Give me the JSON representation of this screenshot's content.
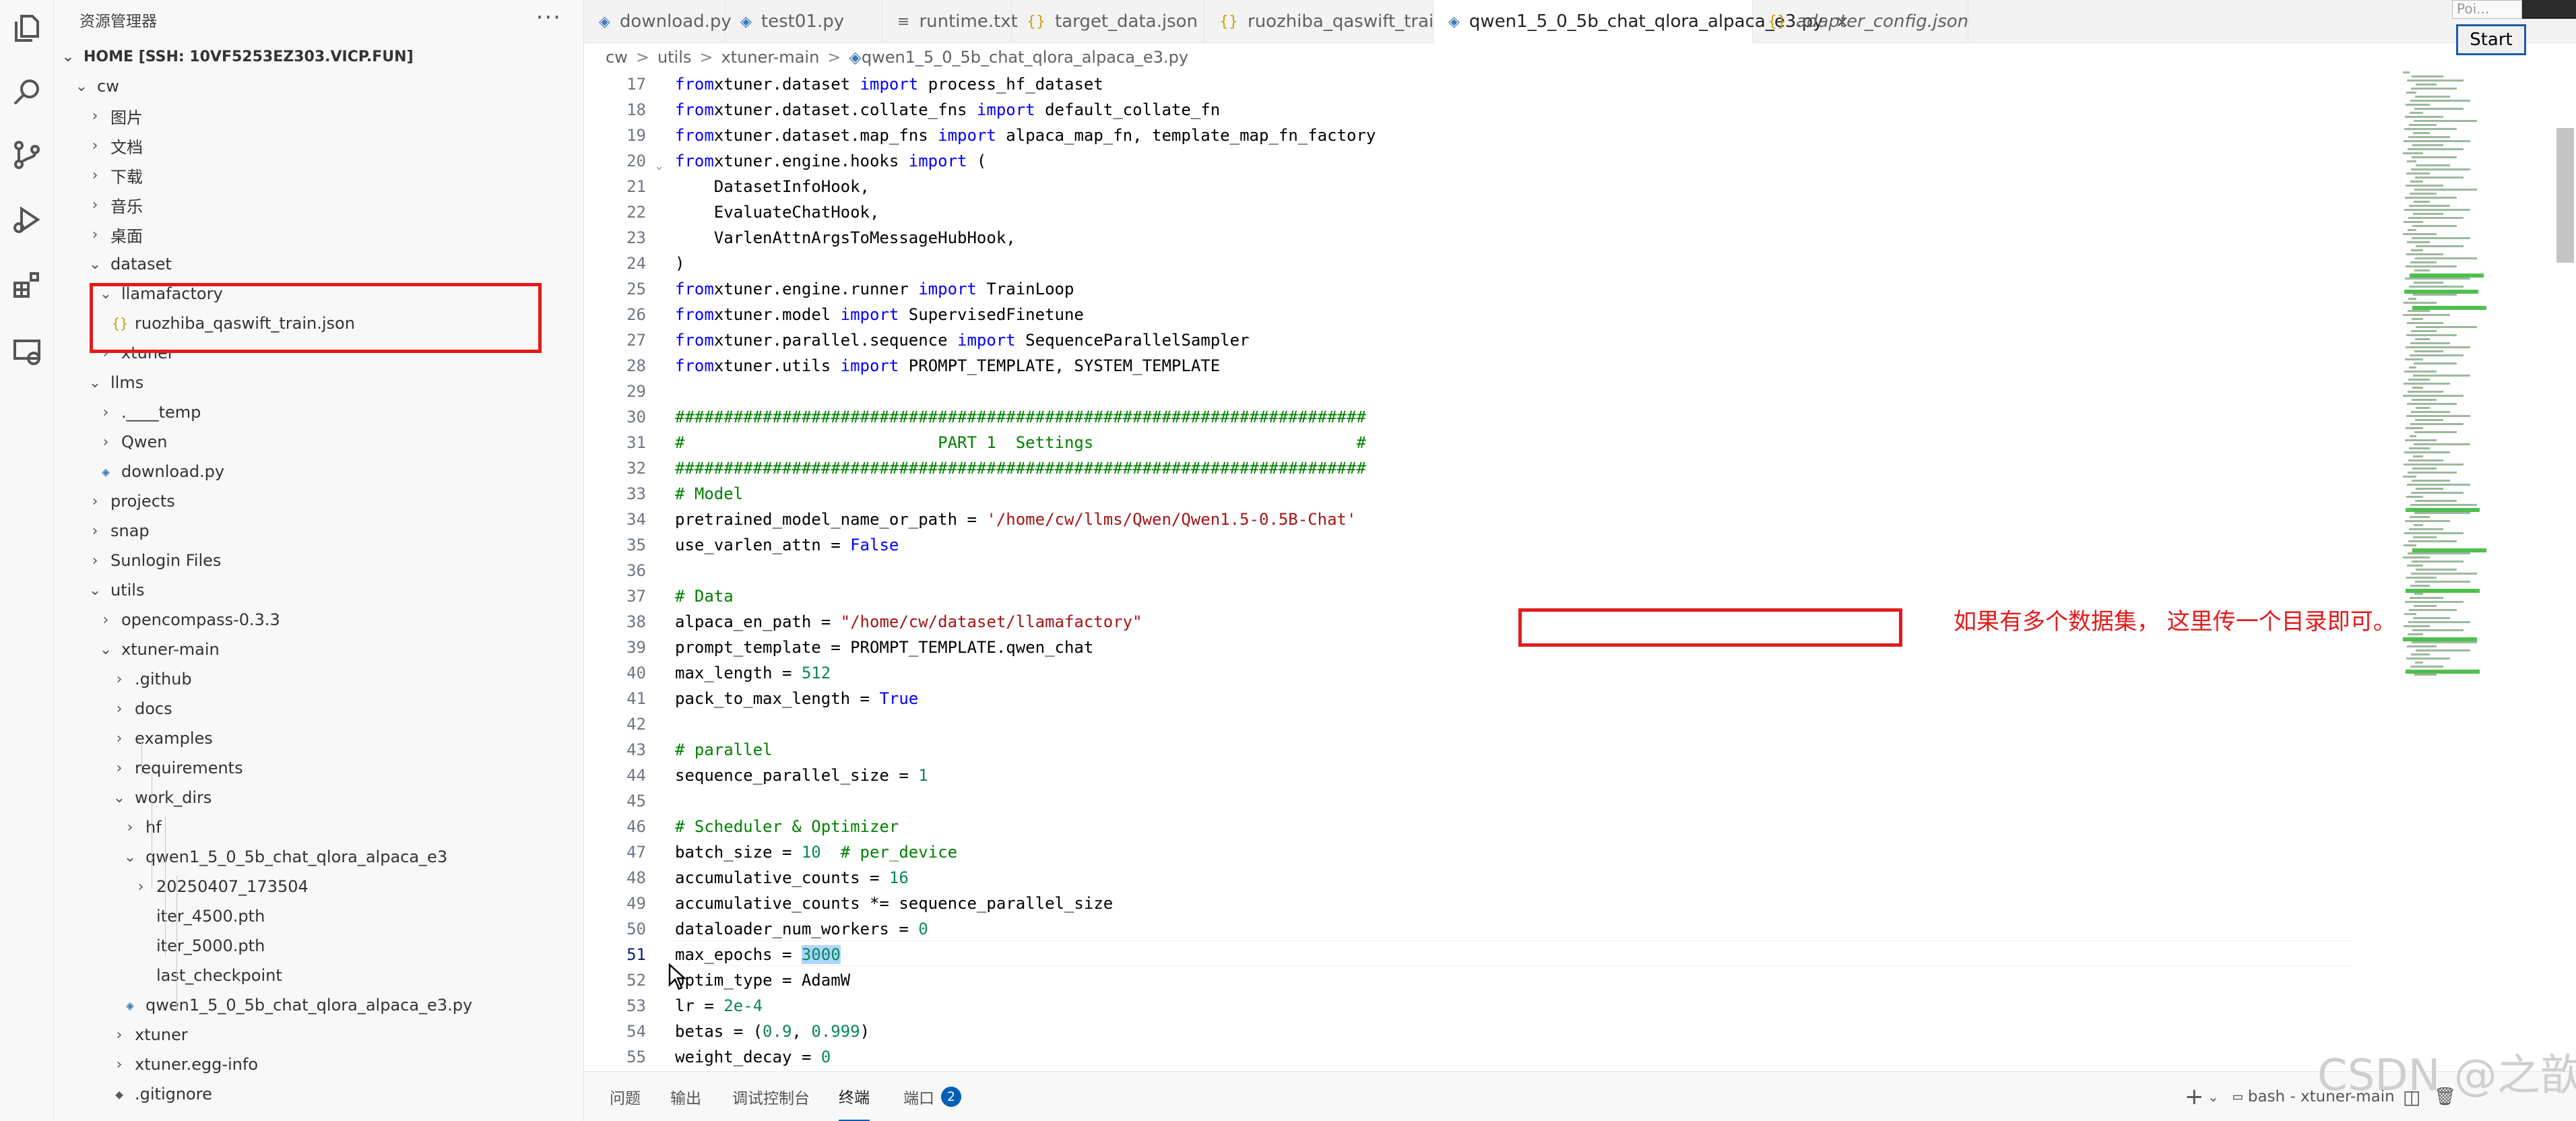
{
  "activity_bar": {
    "icons": [
      "files-icon",
      "search-icon",
      "source-control-icon",
      "run-debug-icon",
      "extensions-icon",
      "remote-explorer-icon"
    ]
  },
  "sidebar": {
    "title": "资源管理器",
    "more": "···",
    "root": "HOME [SSH: 10VF5253EZ303.VICP.FUN]",
    "items": [
      {
        "label": "cw",
        "depth": 0,
        "type": "folder",
        "open": true
      },
      {
        "label": "图片",
        "depth": 1,
        "type": "folder",
        "open": false
      },
      {
        "label": "文档",
        "depth": 1,
        "type": "folder",
        "open": false
      },
      {
        "label": "下载",
        "depth": 1,
        "type": "folder",
        "open": false
      },
      {
        "label": "音乐",
        "depth": 1,
        "type": "folder",
        "open": false
      },
      {
        "label": "桌面",
        "depth": 1,
        "type": "folder",
        "open": false
      },
      {
        "label": "dataset",
        "depth": 1,
        "type": "folder",
        "open": true
      },
      {
        "label": "llamafactory",
        "depth": 2,
        "type": "folder",
        "open": true
      },
      {
        "label": "ruozhiba_qaswift_train.json",
        "depth": 3,
        "type": "json"
      },
      {
        "label": "xtuner",
        "depth": 2,
        "type": "folder",
        "open": false
      },
      {
        "label": "llms",
        "depth": 1,
        "type": "folder",
        "open": true
      },
      {
        "label": ".____temp",
        "depth": 2,
        "type": "folder",
        "open": false
      },
      {
        "label": "Qwen",
        "depth": 2,
        "type": "folder",
        "open": false
      },
      {
        "label": "download.py",
        "depth": 2,
        "type": "py"
      },
      {
        "label": "projects",
        "depth": 1,
        "type": "folder",
        "open": false
      },
      {
        "label": "snap",
        "depth": 1,
        "type": "folder",
        "open": false
      },
      {
        "label": "Sunlogin Files",
        "depth": 1,
        "type": "folder",
        "open": false
      },
      {
        "label": "utils",
        "depth": 1,
        "type": "folder",
        "open": true
      },
      {
        "label": "opencompass-0.3.3",
        "depth": 2,
        "type": "folder",
        "open": false
      },
      {
        "label": "xtuner-main",
        "depth": 2,
        "type": "folder",
        "open": true
      },
      {
        "label": ".github",
        "depth": 3,
        "type": "folder",
        "open": false
      },
      {
        "label": "docs",
        "depth": 3,
        "type": "folder",
        "open": false
      },
      {
        "label": "examples",
        "depth": 3,
        "type": "folder",
        "open": false
      },
      {
        "label": "requirements",
        "depth": 3,
        "type": "folder",
        "open": false
      },
      {
        "label": "work_dirs",
        "depth": 3,
        "type": "folder",
        "open": true
      },
      {
        "label": "hf",
        "depth": 4,
        "type": "folder",
        "open": false
      },
      {
        "label": "qwen1_5_0_5b_chat_qlora_alpaca_e3",
        "depth": 4,
        "type": "folder",
        "open": true
      },
      {
        "label": "20250407_173504",
        "depth": 5,
        "type": "folder",
        "open": false
      },
      {
        "label": "iter_4500.pth",
        "depth": 5,
        "type": "file"
      },
      {
        "label": "iter_5000.pth",
        "depth": 5,
        "type": "file"
      },
      {
        "label": "last_checkpoint",
        "depth": 5,
        "type": "file"
      },
      {
        "label": "qwen1_5_0_5b_chat_qlora_alpaca_e3.py",
        "depth": 4,
        "type": "py"
      },
      {
        "label": "xtuner",
        "depth": 3,
        "type": "folder",
        "open": false
      },
      {
        "label": "xtuner.egg-info",
        "depth": 3,
        "type": "folder",
        "open": false
      },
      {
        "label": ".gitignore",
        "depth": 3,
        "type": "git"
      }
    ]
  },
  "tabs": [
    {
      "label": "download.py",
      "type": "py"
    },
    {
      "label": "test01.py",
      "type": "py"
    },
    {
      "label": "runtime.txt",
      "type": "txt"
    },
    {
      "label": "target_data.json",
      "type": "json"
    },
    {
      "label": "ruozhiba_qaswift_train.json",
      "type": "json"
    },
    {
      "label": "qwen1_5_0_5b_chat_qlora_alpaca_e3.py",
      "type": "py",
      "active": true,
      "close": "×"
    },
    {
      "label": "adapter_config.json",
      "type": "json",
      "italic": true
    }
  ],
  "breadcrumb": [
    "cw",
    "utils",
    "xtuner-main",
    "qwen1_5_0_5b_chat_qlora_alpaca_e3.py"
  ],
  "breadcrumb_sep": ">",
  "editor": {
    "current_line": 51,
    "lines": [
      {
        "n": "17",
        "t": [
          [
            "kw",
            "from"
          ],
          [
            "",
            "xtuner.dataset "
          ],
          [
            "kw",
            "import"
          ],
          [
            "",
            " process_hf_dataset"
          ]
        ]
      },
      {
        "n": "18",
        "t": [
          [
            "kw",
            "from"
          ],
          [
            "",
            "xtuner.dataset.collate_fns "
          ],
          [
            "kw",
            "import"
          ],
          [
            "",
            " default_collate_fn"
          ]
        ]
      },
      {
        "n": "19",
        "t": [
          [
            "kw",
            "from"
          ],
          [
            "",
            "xtuner.dataset.map_fns "
          ],
          [
            "kw",
            "import"
          ],
          [
            "",
            " alpaca_map_fn, template_map_fn_factory"
          ]
        ]
      },
      {
        "n": "20",
        "t": [
          [
            "kw",
            "from"
          ],
          [
            "",
            "xtuner.engine.hooks "
          ],
          [
            "kw",
            "import"
          ],
          [
            "",
            " ("
          ]
        ]
      },
      {
        "n": "21",
        "t": [
          [
            "",
            "    DatasetInfoHook,"
          ]
        ]
      },
      {
        "n": "22",
        "t": [
          [
            "",
            "    EvaluateChatHook,"
          ]
        ]
      },
      {
        "n": "23",
        "t": [
          [
            "",
            "    VarlenAttnArgsToMessageHubHook,"
          ]
        ]
      },
      {
        "n": "24",
        "t": [
          [
            "",
            ")"
          ]
        ]
      },
      {
        "n": "25",
        "t": [
          [
            "kw",
            "from"
          ],
          [
            "",
            "xtuner.engine.runner "
          ],
          [
            "kw",
            "import"
          ],
          [
            "",
            " TrainLoop"
          ]
        ]
      },
      {
        "n": "26",
        "t": [
          [
            "kw",
            "from"
          ],
          [
            "",
            "xtuner.model "
          ],
          [
            "kw",
            "import"
          ],
          [
            "",
            " SupervisedFinetune"
          ]
        ]
      },
      {
        "n": "27",
        "t": [
          [
            "kw",
            "from"
          ],
          [
            "",
            "xtuner.parallel.sequence "
          ],
          [
            "kw",
            "import"
          ],
          [
            "",
            " SequenceParallelSampler"
          ]
        ]
      },
      {
        "n": "28",
        "t": [
          [
            "kw",
            "from"
          ],
          [
            "",
            "xtuner.utils "
          ],
          [
            "kw",
            "import"
          ],
          [
            "",
            " PROMPT_TEMPLATE, SYSTEM_TEMPLATE"
          ]
        ]
      },
      {
        "n": "29",
        "t": []
      },
      {
        "n": "30",
        "t": [
          [
            "cm",
            "#######################################################################"
          ]
        ]
      },
      {
        "n": "31",
        "t": [
          [
            "cm",
            "#                          PART 1  Settings                           #"
          ]
        ]
      },
      {
        "n": "32",
        "t": [
          [
            "cm",
            "#######################################################################"
          ]
        ]
      },
      {
        "n": "33",
        "t": [
          [
            "cm",
            "# Model"
          ]
        ]
      },
      {
        "n": "34",
        "t": [
          [
            "",
            "pretrained_model_name_or_path = "
          ],
          [
            "st",
            "'/home/cw/llms/Qwen/Qwen1.5-0.5B-Chat'"
          ]
        ]
      },
      {
        "n": "35",
        "t": [
          [
            "",
            "use_varlen_attn = "
          ],
          [
            "kw",
            "False"
          ]
        ]
      },
      {
        "n": "36",
        "t": []
      },
      {
        "n": "37",
        "t": [
          [
            "cm",
            "# Data"
          ]
        ]
      },
      {
        "n": "38",
        "t": [
          [
            "",
            "alpaca_en_path = "
          ],
          [
            "st",
            "\"/home/cw/dataset/llamafactory\""
          ]
        ]
      },
      {
        "n": "39",
        "t": [
          [
            "",
            "prompt_template = PROMPT_TEMPLATE.qwen_chat"
          ]
        ]
      },
      {
        "n": "40",
        "t": [
          [
            "",
            "max_length = "
          ],
          [
            "nm",
            "512"
          ]
        ]
      },
      {
        "n": "41",
        "t": [
          [
            "",
            "pack_to_max_length = "
          ],
          [
            "kw",
            "True"
          ]
        ]
      },
      {
        "n": "42",
        "t": []
      },
      {
        "n": "43",
        "t": [
          [
            "cm",
            "# parallel"
          ]
        ]
      },
      {
        "n": "44",
        "t": [
          [
            "",
            "sequence_parallel_size = "
          ],
          [
            "nm",
            "1"
          ]
        ]
      },
      {
        "n": "45",
        "t": []
      },
      {
        "n": "46",
        "t": [
          [
            "cm",
            "# Scheduler & Optimizer"
          ]
        ]
      },
      {
        "n": "47",
        "t": [
          [
            "",
            "batch_size = "
          ],
          [
            "nm",
            "10"
          ],
          [
            "",
            "  "
          ],
          [
            "cm",
            "# per_device"
          ]
        ]
      },
      {
        "n": "48",
        "t": [
          [
            "",
            "accumulative_counts = "
          ],
          [
            "nm",
            "16"
          ]
        ]
      },
      {
        "n": "49",
        "t": [
          [
            "",
            "accumulative_counts *= sequence_parallel_size"
          ]
        ]
      },
      {
        "n": "50",
        "t": [
          [
            "",
            "dataloader_num_workers = "
          ],
          [
            "nm",
            "0"
          ]
        ]
      },
      {
        "n": "51",
        "t": [
          [
            "",
            "max_epochs = "
          ],
          [
            "nm sel",
            "3000"
          ]
        ]
      },
      {
        "n": "52",
        "t": [
          [
            "",
            "optim_type = AdamW"
          ]
        ]
      },
      {
        "n": "53",
        "t": [
          [
            "",
            "lr = "
          ],
          [
            "nm",
            "2e-4"
          ]
        ]
      },
      {
        "n": "54",
        "t": [
          [
            "",
            "betas = ("
          ],
          [
            "nm",
            "0.9"
          ],
          [
            "",
            ", "
          ],
          [
            "nm",
            "0.999"
          ],
          [
            "",
            ")"
          ]
        ]
      },
      {
        "n": "55",
        "t": [
          [
            "",
            "weight_decay = "
          ],
          [
            "nm",
            "0"
          ]
        ]
      }
    ]
  },
  "annotation": "如果有多个数据集， 这里传一个目录即可。",
  "panel": {
    "tabs": [
      "问题",
      "输出",
      "调试控制台",
      "终端",
      "端口"
    ],
    "active": "终端",
    "ports_badge": "2",
    "terminal_add": "+",
    "terminal_chevron": "⌄",
    "terminal_name": "bash - xtuner-main"
  },
  "overlay": {
    "start_button": "Start",
    "poi_text": "Poi...",
    "watermark": "CSDN @之歆"
  },
  "colors": {
    "highlight_box": "#e21b1b",
    "keyword": "#0000ff",
    "comment": "#008000",
    "string": "#a31515",
    "number": "#098658",
    "accent": "#005fb8"
  }
}
